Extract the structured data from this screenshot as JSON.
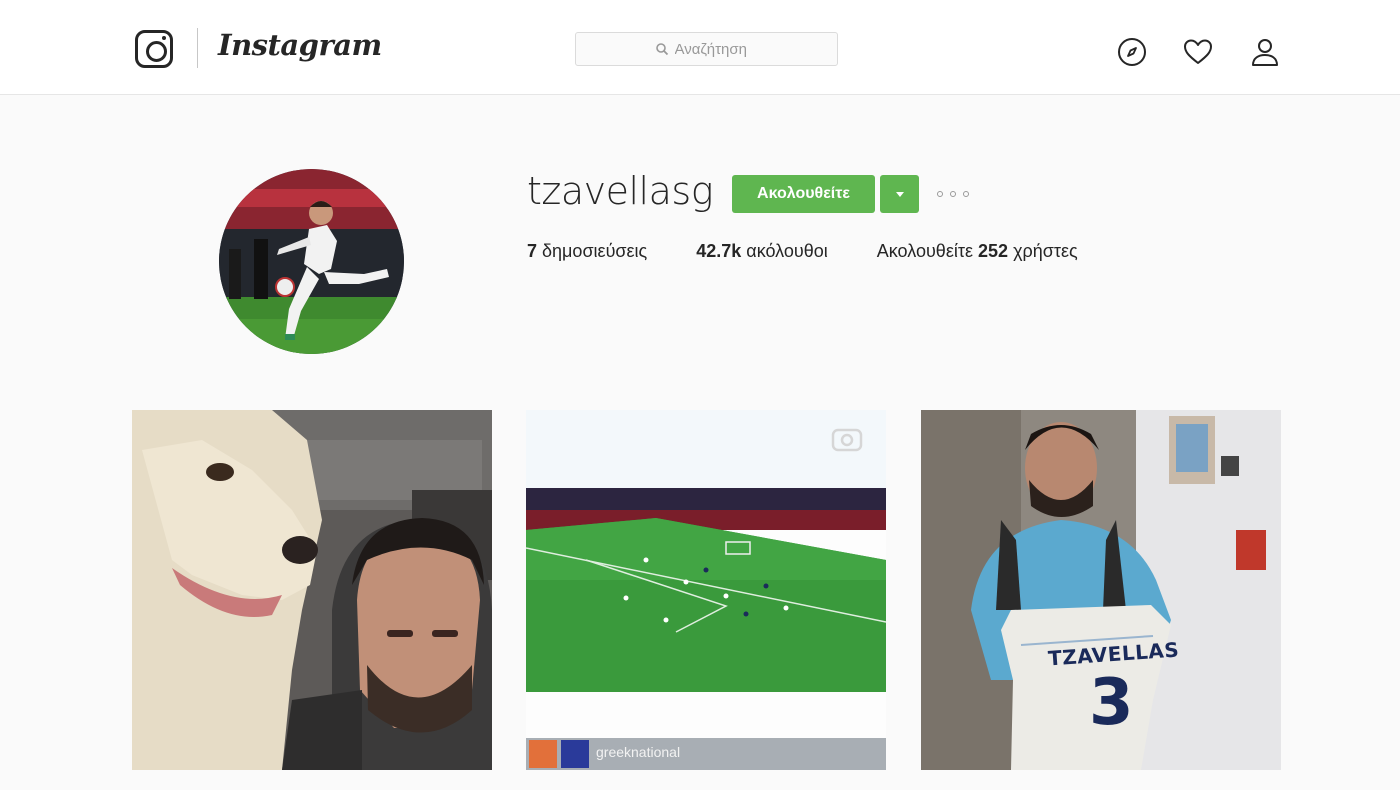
{
  "header": {
    "brand": "Instagram",
    "search_placeholder": "Αναζήτηση",
    "icons": [
      "instagram-glyph-icon",
      "search-icon",
      "compass-icon",
      "heart-icon",
      "person-icon"
    ]
  },
  "profile": {
    "username": "tzavellasg",
    "follow_label": "Ακολουθείτε",
    "stats": {
      "posts_count": "7",
      "posts_label": "δημοσιεύσεις",
      "followers_count": "42.7k",
      "followers_label": "ακόλουθοι",
      "following_prefix": "Ακολουθείτε",
      "following_count": "252",
      "following_label": "χρήστες"
    }
  },
  "posts": [
    {
      "description": "selfie-with-dog"
    },
    {
      "description": "football-match-video",
      "account_label": "greeknational"
    },
    {
      "description": "holding-jersey",
      "jersey_name": "TZAVELLAS",
      "jersey_number": "3"
    }
  ],
  "colors": {
    "accent": "#5fb650",
    "text": "#262626",
    "muted": "#999999",
    "background": "#fafafa"
  }
}
